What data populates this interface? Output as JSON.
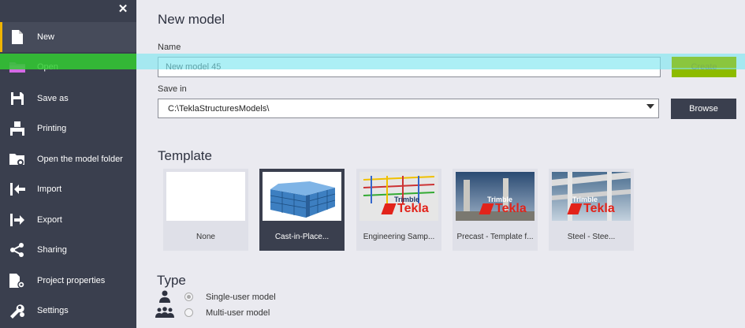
{
  "sidebar": {
    "items": [
      {
        "label": "New"
      },
      {
        "label": "Open"
      },
      {
        "label": "Save as"
      },
      {
        "label": "Printing"
      },
      {
        "label": "Open the model folder"
      },
      {
        "label": "Import"
      },
      {
        "label": "Export"
      },
      {
        "label": "Sharing"
      },
      {
        "label": "Project properties"
      },
      {
        "label": "Settings"
      }
    ]
  },
  "main": {
    "title": "New model",
    "name_label": "Name",
    "name_value": "New model 45",
    "create_label": "Create",
    "save_in_label": "Save in",
    "save_in_value": "C:\\TeklaStructuresModels\\",
    "browse_label": "Browse",
    "template_title": "Template",
    "templates": [
      {
        "label": "None"
      },
      {
        "label": "Cast-in-Place..."
      },
      {
        "label": "Engineering Samp..."
      },
      {
        "label": "Precast - Template f..."
      },
      {
        "label": "Steel - Stee..."
      }
    ],
    "type_title": "Type",
    "types": [
      {
        "label": "Single-user model"
      },
      {
        "label": "Multi-user model"
      }
    ]
  },
  "brand": {
    "trimble": "Trimble",
    "tekla": "Tekla"
  },
  "colors": {
    "sidebar_bg": "#3a3f4e",
    "accent": "#f0b400",
    "create_green": "#8dbb00",
    "highlight_cyan": "#7fe6f0",
    "highlight_green": "#33cc33",
    "tekla_red": "#e2231a"
  }
}
